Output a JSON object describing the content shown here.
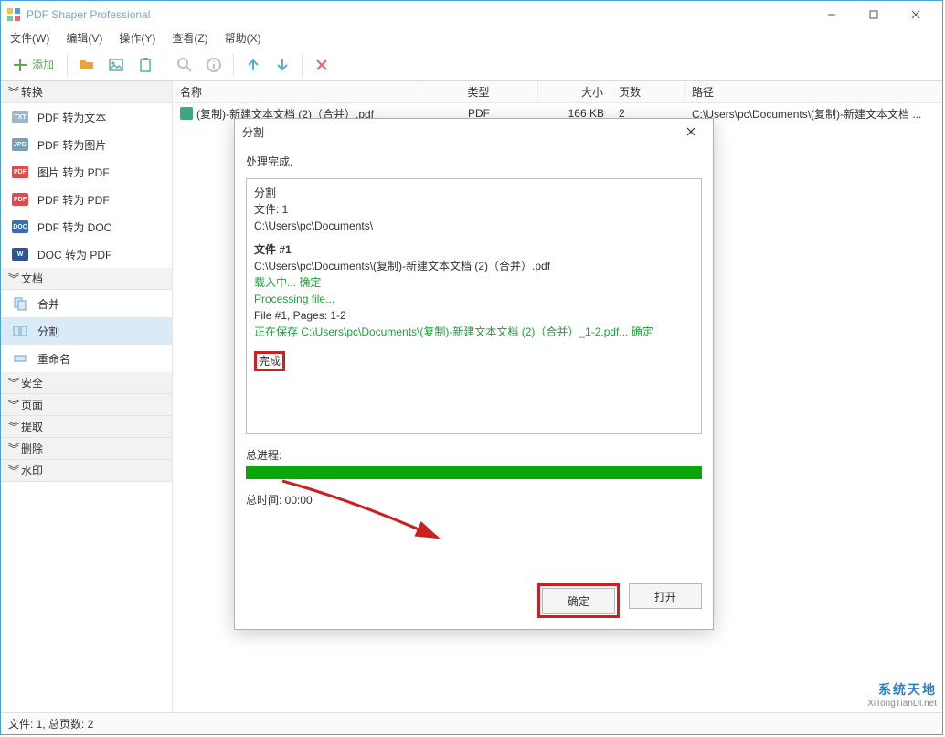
{
  "title": "PDF Shaper Professional",
  "menus": {
    "file": "文件(W)",
    "edit": "编辑(V)",
    "action": "操作(Y)",
    "view": "查看(Z)",
    "help": "帮助(X)"
  },
  "toolbar": {
    "add": "添加"
  },
  "sidebar": {
    "groups": [
      {
        "label": "转换",
        "items": [
          "PDF 转为文本",
          "PDF 转为图片",
          "图片 转为 PDF",
          "PDF 转为 PDF",
          "PDF 转为 DOC",
          "DOC 转为 PDF"
        ]
      },
      {
        "label": "文档",
        "items": [
          "合并",
          "分割",
          "重命名"
        ]
      },
      {
        "label": "安全",
        "items": []
      },
      {
        "label": "页面",
        "items": []
      },
      {
        "label": "提取",
        "items": []
      },
      {
        "label": "删除",
        "items": []
      },
      {
        "label": "水印",
        "items": []
      }
    ],
    "selected": "分割"
  },
  "columns": {
    "name": "名称",
    "type": "类型",
    "size": "大小",
    "pages": "页数",
    "path": "路径"
  },
  "row": {
    "name": "(复制)-新建文本文档 (2)（合并）.pdf",
    "type": "PDF",
    "size": "166 KB",
    "pages": "2",
    "path": "C:\\Users\\pc\\Documents\\(复制)-新建文本文档 ..."
  },
  "modal": {
    "title": "分割",
    "done": "处理完成.",
    "l1": "分割",
    "l2": "文件: 1",
    "l3": "C:\\Users\\pc\\Documents\\",
    "l4": "文件 #1",
    "l5": "C:\\Users\\pc\\Documents\\(复制)-新建文本文档 (2)（合并）.pdf",
    "l6": "载入中... 确定",
    "l7": "Processing file...",
    "l8": "File #1, Pages: 1-2",
    "l9": "正在保存 C:\\Users\\pc\\Documents\\(复制)-新建文本文档 (2)（合并）_1-2.pdf... 确定",
    "finish": "完成",
    "progress_label": "总进程:",
    "time_label": "总时间: 00:00",
    "ok": "确定",
    "open": "打开"
  },
  "statusbar": "文件: 1, 总页数: 2",
  "watermark": {
    "top": "系统天地",
    "bot": "XiTongTianDi.net"
  }
}
